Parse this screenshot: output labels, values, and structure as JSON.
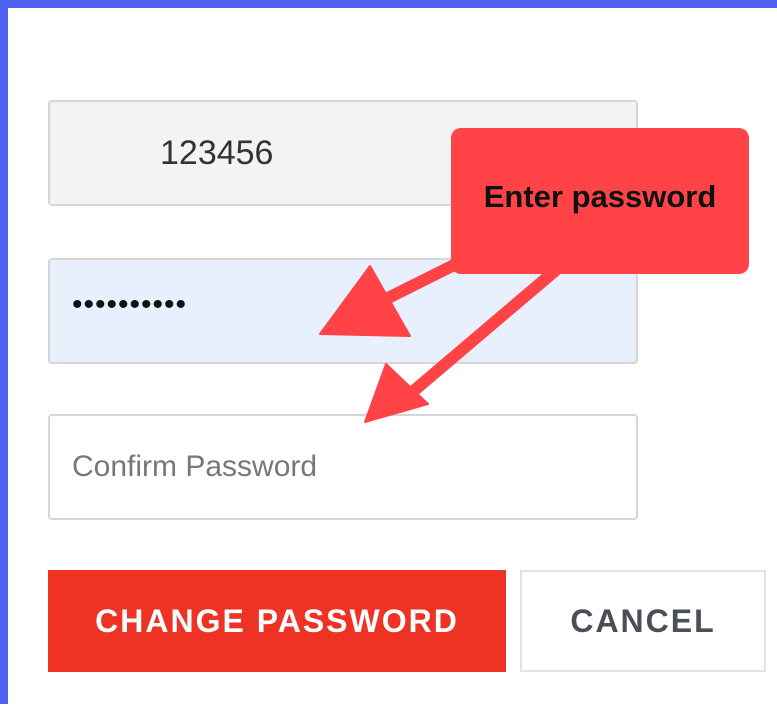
{
  "form": {
    "username_value": "123456",
    "password_masked": "••••••••••",
    "confirm_placeholder": "Confirm Password",
    "confirm_value": ""
  },
  "buttons": {
    "change_label": "CHANGE PASSWORD",
    "cancel_label": "CANCEL"
  },
  "annotation": {
    "callout_text": "Enter password"
  },
  "colors": {
    "frame_border": "#4f63f0",
    "primary_button": "#ee3224",
    "callout": "#ff4346",
    "password_field_bg": "#e8f0fe"
  }
}
